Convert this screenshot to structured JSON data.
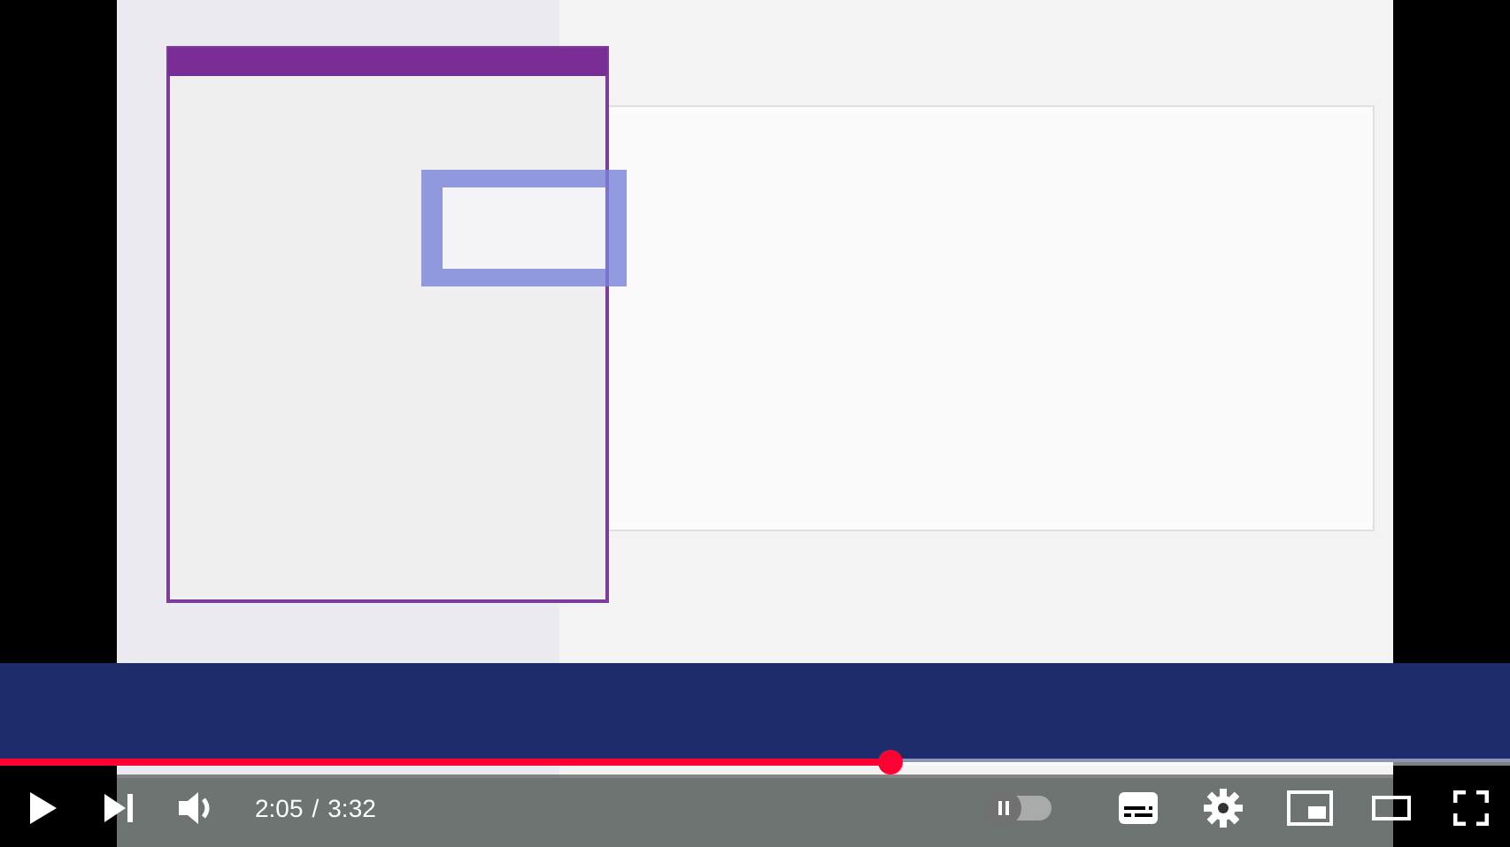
{
  "progress": {
    "level": 0.59
  },
  "time": {
    "current": "2:05",
    "separator": "/",
    "duration": "3:32"
  },
  "autoplay": {
    "on": false
  }
}
